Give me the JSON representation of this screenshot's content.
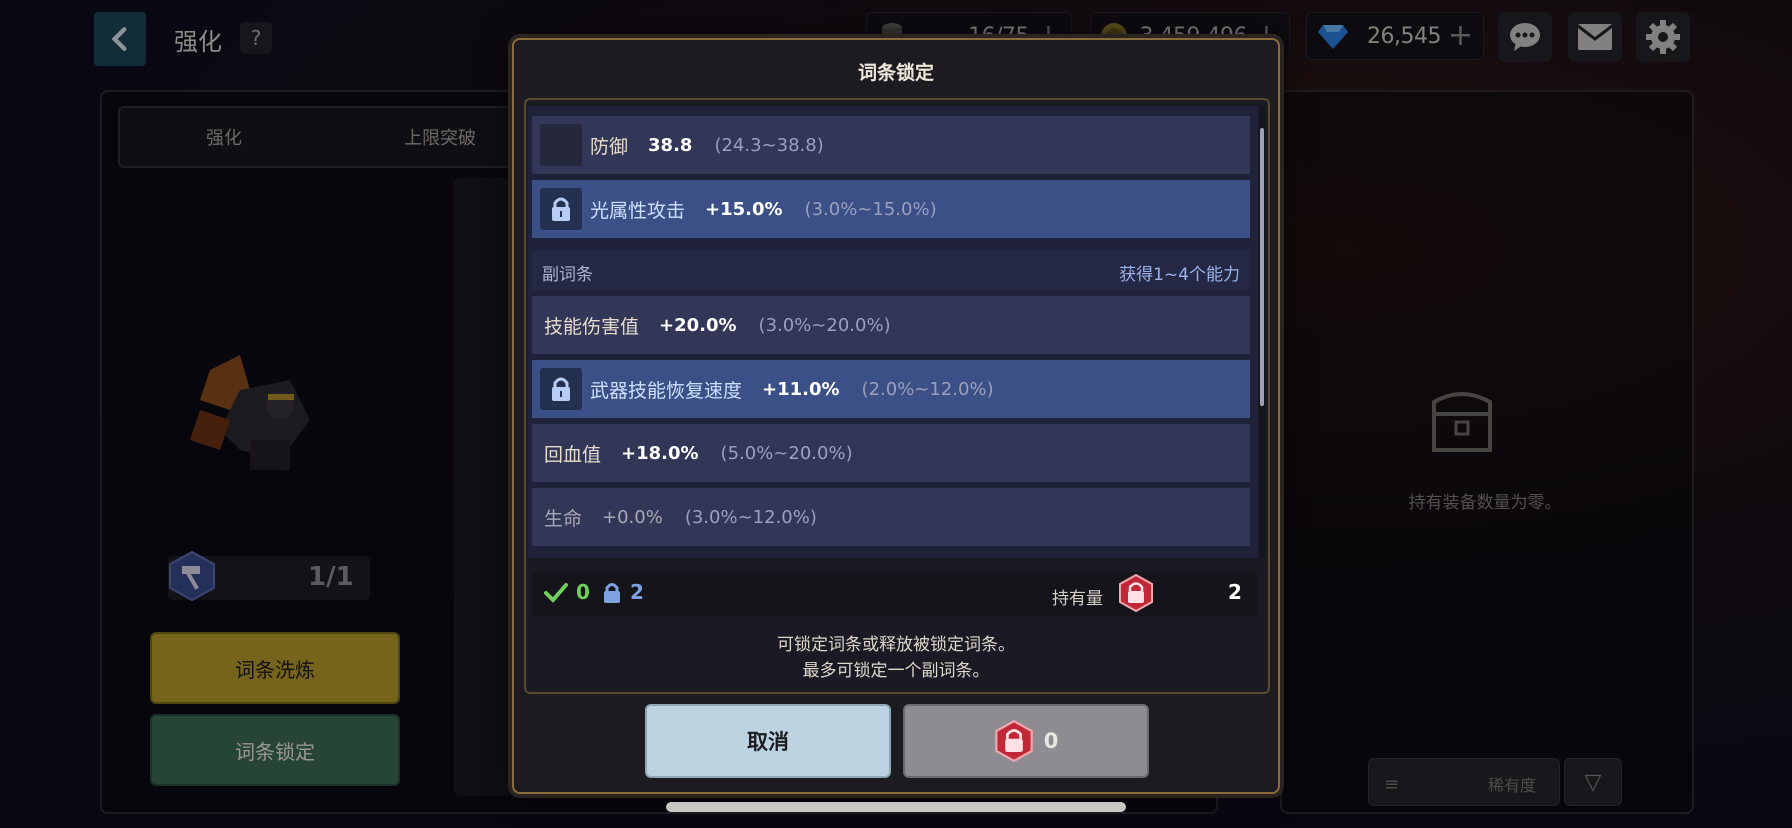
{
  "header": {
    "title": "强化",
    "help": "?",
    "resources": [
      {
        "icon": "stamina-icon",
        "value": "16/75"
      },
      {
        "icon": "gold-coin-icon",
        "value": "3,459,496"
      },
      {
        "icon": "gem-icon",
        "value": "26,545"
      }
    ],
    "plus": "+"
  },
  "left": {
    "tabs": [
      "强化",
      "上限突破"
    ],
    "level": "1/1",
    "refine_button": "词条洗炼",
    "lock_button": "词条锁定"
  },
  "right": {
    "empty_text": "持有装备数量为零。",
    "sort_label": "稀有度"
  },
  "modal": {
    "title": "词条锁定",
    "main_rows": [
      {
        "name": "防御",
        "value": "38.8",
        "range": "(24.3~38.8)",
        "locked": false
      },
      {
        "name": "光属性攻击",
        "value": "+15.0%",
        "range": "(3.0%~15.0%)",
        "locked": true
      }
    ],
    "sub_header": {
      "label": "副词条",
      "info": "获得1~4个能力"
    },
    "sub_rows": [
      {
        "name": "技能伤害值",
        "value": "+20.0%",
        "range": "(3.0%~20.0%)",
        "locked": false
      },
      {
        "name": "武器技能恢复速度",
        "value": "+11.0%",
        "range": "(2.0%~12.0%)",
        "locked": true
      },
      {
        "name": "回血值",
        "value": "+18.0%",
        "range": "(5.0%~20.0%)",
        "locked": false
      },
      {
        "name": "生命",
        "value": "+0.0%",
        "range": "(3.0%~12.0%)",
        "locked": false
      }
    ],
    "selected_count": "0",
    "locked_count": "2",
    "hold_label": "持有量",
    "hold_count": "2",
    "info_line1": "可锁定词条或释放被锁定词条。",
    "info_line2": "最多可锁定一个副词条。",
    "cancel_label": "取消",
    "confirm_cost": "0"
  },
  "colors": {
    "locked_row": "#3b5086",
    "row": "#323657",
    "modal_border": "#8a6c3a",
    "refine_button": "#b59a2c",
    "lock_button": "#3d6a55"
  }
}
